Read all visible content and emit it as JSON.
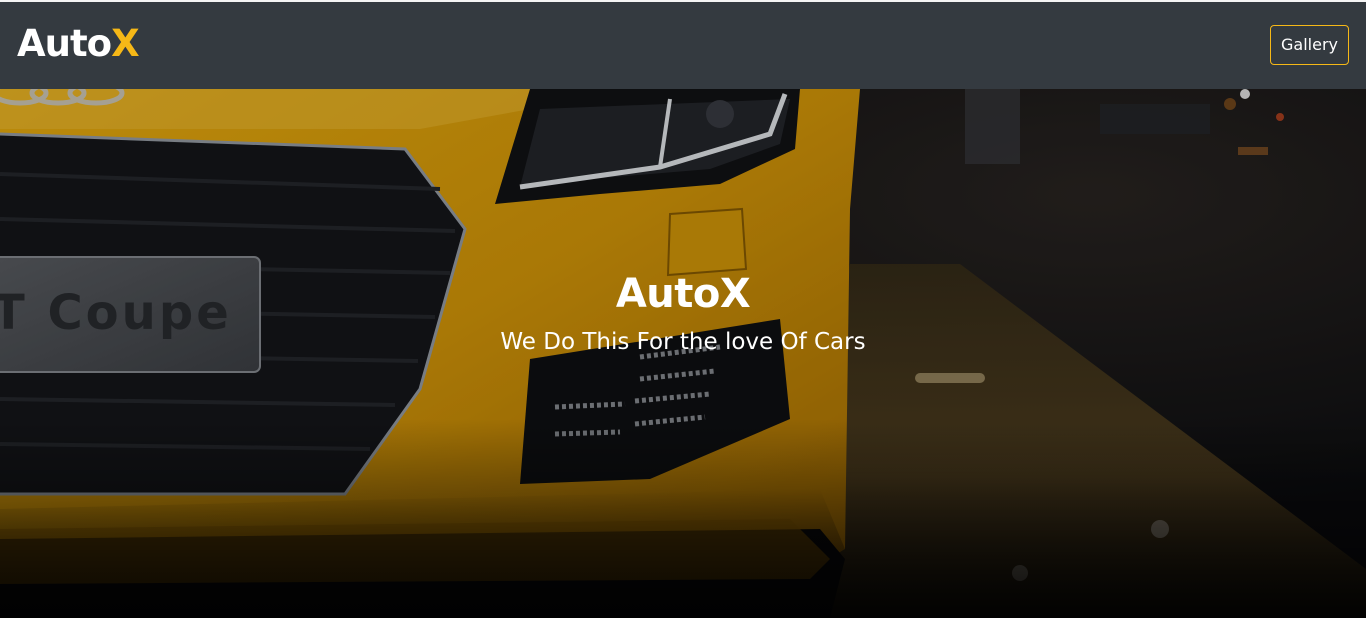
{
  "navbar": {
    "brand_main": "Auto",
    "brand_accent": "X",
    "gallery_label": "Gallery"
  },
  "hero": {
    "title": "AutoX",
    "subtitle": "We Do This For the love Of Cars",
    "plate_text": "T Coupe"
  },
  "colors": {
    "navbar_bg": "#343a40",
    "accent": "#f6b817",
    "car_yellow": "#e6a80c"
  }
}
